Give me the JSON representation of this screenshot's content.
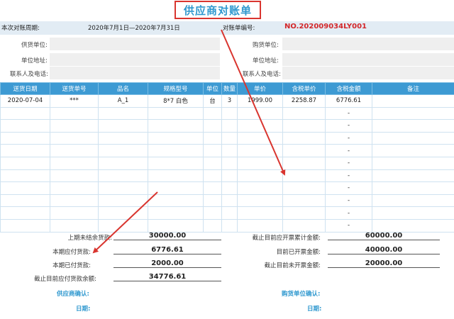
{
  "title": "供应商对账单",
  "period": {
    "label": "本次对账周期:",
    "value": "2020年7月1日—2020年7月31日"
  },
  "bill": {
    "label": "对账单编号:",
    "value": "NO.202009034LY001"
  },
  "supplier_info": {
    "unit": "供货单位:",
    "address": "单位地址:",
    "contact": "联系人及电话:"
  },
  "buyer_info": {
    "unit": "购货单位:",
    "address": "单位地址:",
    "contact": "联系人及电话:"
  },
  "table": {
    "headers": [
      "送货日期",
      "送货单号",
      "品名",
      "规格型号",
      "单位",
      "数量",
      "单价",
      "含税单价",
      "含税金额",
      "备注"
    ],
    "first_row": [
      "2020-07-04",
      "***",
      "A_1",
      "8*7 白色",
      "台",
      "3",
      "1999.00",
      "2258.87",
      "6776.61",
      ""
    ],
    "empty_amount": "-"
  },
  "summary_left": [
    {
      "label": "上期未结余货款:",
      "value": "30000.00"
    },
    {
      "label": "本期应付货款:",
      "value": "6776.61"
    },
    {
      "label": "本期已付货款:",
      "value": "2000.00"
    },
    {
      "label": "截止目前应付货款余额:",
      "value": "34776.61"
    }
  ],
  "summary_right": [
    {
      "label": "截止目前应开票累计金额:",
      "value": "60000.00"
    },
    {
      "label": "目前已开票金额:",
      "value": "40000.00"
    },
    {
      "label": "截止目前未开票金额:",
      "value": "20000.00"
    }
  ],
  "confirm": {
    "supplier": "供应商确认:",
    "supplier_date": "日期:",
    "buyer": "购货单位确认:",
    "buyer_date": "日期:"
  },
  "colors": {
    "accent": "#2f98cf",
    "header_bg": "#3d9ad3",
    "annotation_red": "#d9352f"
  }
}
